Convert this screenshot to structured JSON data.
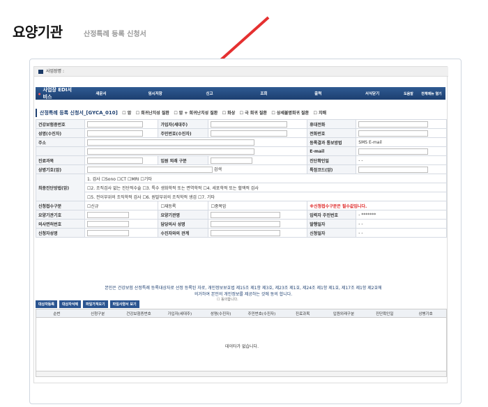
{
  "header": {
    "title": "요양기관",
    "subtitle": "산정특례 등록 신청서"
  },
  "biz": {
    "label": "사업장명 :"
  },
  "nav": {
    "logo": "사업장 EDI서비스",
    "items": [
      "새문서",
      "임시저장",
      "신고",
      "조회",
      "출력",
      "서식닫기"
    ],
    "help": "도움말",
    "menu": "전체메뉴 열기"
  },
  "form": {
    "title": "산정특례 등록 신청서_[GYCA_010]",
    "checks": [
      "암",
      "희귀난치성 질환",
      "암 + 희귀난치성 질환",
      "화상",
      "극 희귀 질환",
      "상세불명희귀 질환",
      "치매"
    ]
  },
  "rows": [
    [
      "건강보험증번호",
      "",
      "가입자(세대주)",
      "",
      "휴대전화",
      ""
    ],
    [
      "성명(수진자)",
      "",
      "주민번호(수진자)",
      "",
      "전화번호",
      ""
    ],
    [
      "주소",
      "",
      "",
      "",
      "등록결과 통보방법",
      "SMS  E-mail"
    ],
    [
      "",
      "",
      "",
      "",
      "E-mail",
      ""
    ],
    [
      "진료과목",
      "",
      "입원 외래 구분",
      "",
      "진단확인일",
      "- -"
    ],
    [
      "상병기호(암)",
      "",
      "검색",
      "",
      "특정코드(암)",
      ""
    ]
  ],
  "diag": {
    "label": "최종진단방법(암)",
    "opts1": [
      "1. 검사",
      "Sono",
      "CT",
      "MRI",
      "기타"
    ],
    "opts2": [
      "2. 조직검사 없는 진단적수술",
      "3. 특수 생화학적 또는 면역학적",
      "4. 세포학적 또는 혈액적 검사"
    ],
    "opts3": [
      "5. 전이부위의 조직학적 검사",
      "6. 원발부위의 조직학적 생검",
      "7. 기타"
    ]
  },
  "rows2": [
    [
      "신청접수구분",
      "신규",
      "재등록",
      "중복암",
      "※신청접수구분은 필수값입니다."
    ],
    [
      "요양기관기호",
      "",
      "요양기관명",
      "",
      "입력자 주민번호",
      "- *******"
    ],
    [
      "의사면허번호",
      "",
      "담당의사 성명",
      "",
      "발행일자",
      "- -"
    ],
    [
      "신청자성명",
      "",
      "수진자와의 관계",
      "",
      "신청일자",
      "- -"
    ]
  ],
  "notice": "본인은 건강보험 산정특례 등록대상자로 선정 등록된 자로, 개인정보보호법 제15조 제1항 제3호, 제23조 제1호, 제24조 제1항 제1호, 제17조 제1항 제2호에 의거하여 본인의 개인정보를 제공하는 것에 동의 합니다.",
  "agree": "동의합니다.",
  "buttons": [
    "대상자등록",
    "대상자삭제",
    "파일가져오기",
    "파일사양서 보기"
  ],
  "grid": {
    "cols": [
      "순번",
      "신청구분",
      "건강보험증번호",
      "가입자(세대주)",
      "성명(수진자)",
      "주민번호(수진자)",
      "진료과목",
      "입원외래구분",
      "진단확인일",
      "상병기호"
    ],
    "empty": "데이타가 없습니다."
  },
  "colors": {
    "arrow": "#e53030",
    "nav": "#1d3f70"
  }
}
